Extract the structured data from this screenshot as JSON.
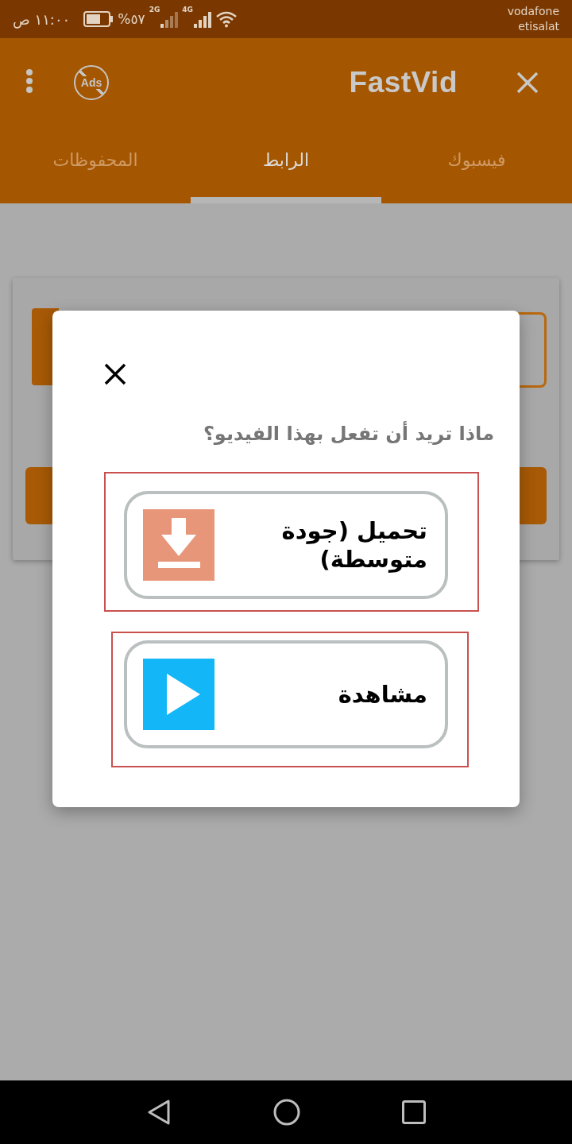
{
  "status_bar": {
    "carriers": [
      "vodafone",
      "etisalat"
    ],
    "networks": [
      {
        "type": "4G"
      },
      {
        "type": "2G"
      }
    ],
    "battery": "%٥٧",
    "time": "١١:٠٠ ص"
  },
  "app_bar": {
    "ads_label": "Ads",
    "title": "FastVid"
  },
  "tabs": [
    {
      "label": "فيسبوك",
      "selected": false
    },
    {
      "label": "الرابط",
      "selected": true
    },
    {
      "label": "المحفوظات",
      "selected": false
    }
  ],
  "dialog": {
    "question": "ماذا تريد أن تفعل بهذا الفيديو؟",
    "options": [
      {
        "kind": "download",
        "label": "تحميل (جودة متوسطة)"
      },
      {
        "kind": "watch",
        "label": "مشاهدة"
      }
    ]
  }
}
